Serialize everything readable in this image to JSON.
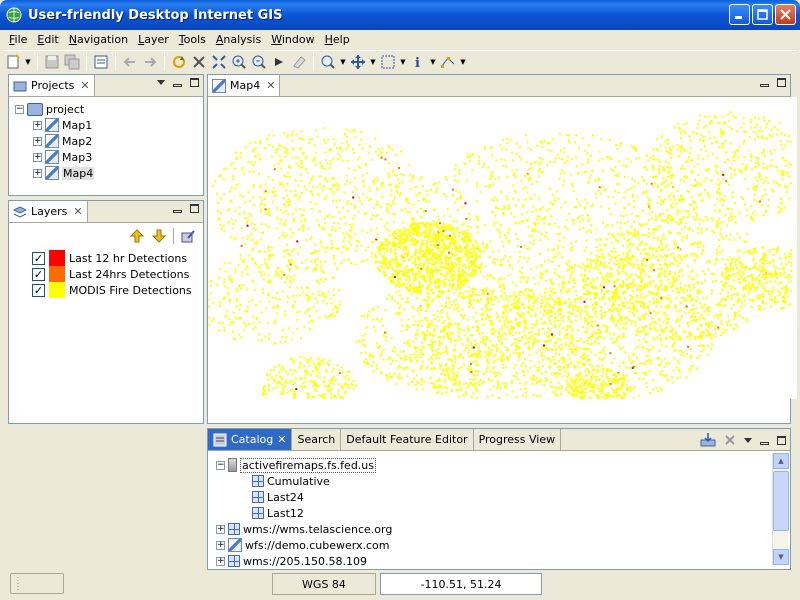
{
  "window": {
    "title": "User-friendly Desktop Internet GIS"
  },
  "menubar": [
    {
      "u": "F",
      "rest": "ile"
    },
    {
      "u": "E",
      "rest": "dit"
    },
    {
      "u": "N",
      "rest": "avigation"
    },
    {
      "u": "L",
      "rest": "ayer"
    },
    {
      "u": "T",
      "rest": "ools"
    },
    {
      "u": "A",
      "rest": "nalysis"
    },
    {
      "u": "W",
      "rest": "indow"
    },
    {
      "u": "H",
      "rest": "elp"
    }
  ],
  "projects": {
    "tab_label": "Projects",
    "root": "project",
    "maps": [
      "Map1",
      "Map2",
      "Map3",
      "Map4"
    ],
    "selected": "Map4"
  },
  "layers": {
    "tab_label": "Layers",
    "items": [
      {
        "label": "Last 12 hr Detections",
        "color": "#ff0000",
        "checked": true
      },
      {
        "label": "Last 24hrs Detections",
        "color": "#ff6a00",
        "checked": true
      },
      {
        "label": "MODIS Fire Detections",
        "color": "#ffff00",
        "checked": true
      }
    ]
  },
  "map": {
    "tab_label": "Map4",
    "point_colors": {
      "modis": "#ffff00",
      "last24": "#ff6a00",
      "last12": "#cc0000"
    }
  },
  "catalog": {
    "tabs": [
      "Catalog",
      "Search",
      "Default Feature Editor",
      "Progress View"
    ],
    "active_tab": "Catalog",
    "server": "activefiremaps.fs.fed.us",
    "server_layers": [
      "Cumulative",
      "Last24",
      "Last12"
    ],
    "other_services": [
      "wms://wms.telascience.org",
      "wfs://demo.cubewerx.com",
      "wms://205.150.58.109"
    ]
  },
  "status": {
    "crs": "WGS 84",
    "coordinates": "-110.51, 51.24"
  }
}
